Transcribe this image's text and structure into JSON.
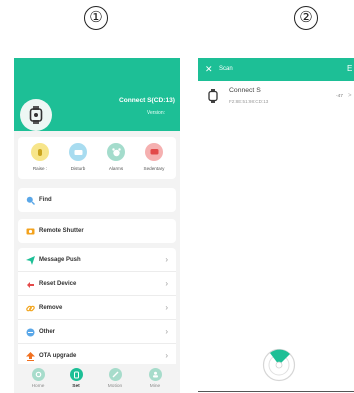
{
  "steps": {
    "first": "①",
    "second": "②"
  },
  "colors": {
    "accent": "#1dbf96",
    "background": "#f3f3f3"
  },
  "device_screen": {
    "device_name": "Connect S(CD:13)",
    "version_label": "Version:",
    "avatar_icon": "watch-icon",
    "features": [
      {
        "label": "Raise :",
        "icon": "hand-icon",
        "color": "#f7e58a"
      },
      {
        "label": "Disturb",
        "icon": "moon-icon",
        "color": "#a8dcf0"
      },
      {
        "label": "Alarms",
        "icon": "alarm-icon",
        "color": "#a4dccc"
      },
      {
        "label": "Sedentary",
        "icon": "chair-icon",
        "color": "#f5b0b0"
      }
    ],
    "find_label": "Find",
    "remote_shutter_label": "Remote Shutter",
    "menu": [
      {
        "label": "Message Push",
        "icon": "send-icon"
      },
      {
        "label": "Reset Device",
        "icon": "reset-icon"
      },
      {
        "label": "Remove",
        "icon": "link-icon"
      },
      {
        "label": "Other",
        "icon": "more-icon"
      },
      {
        "label": "OTA upgrade",
        "icon": "upgrade-icon"
      }
    ],
    "tabs": [
      {
        "label": "Home",
        "active": false
      },
      {
        "label": "Set",
        "active": true
      },
      {
        "label": "Motion",
        "active": false
      },
      {
        "label": "Mine",
        "active": false
      }
    ]
  },
  "scan_screen": {
    "title": "Scan",
    "close_icon": "close-icon",
    "header_right": "E",
    "device": {
      "name": "Connect S",
      "mac": "F2:8E:51:98:CD:13",
      "rssi": "-47",
      "arrow": ">"
    }
  }
}
